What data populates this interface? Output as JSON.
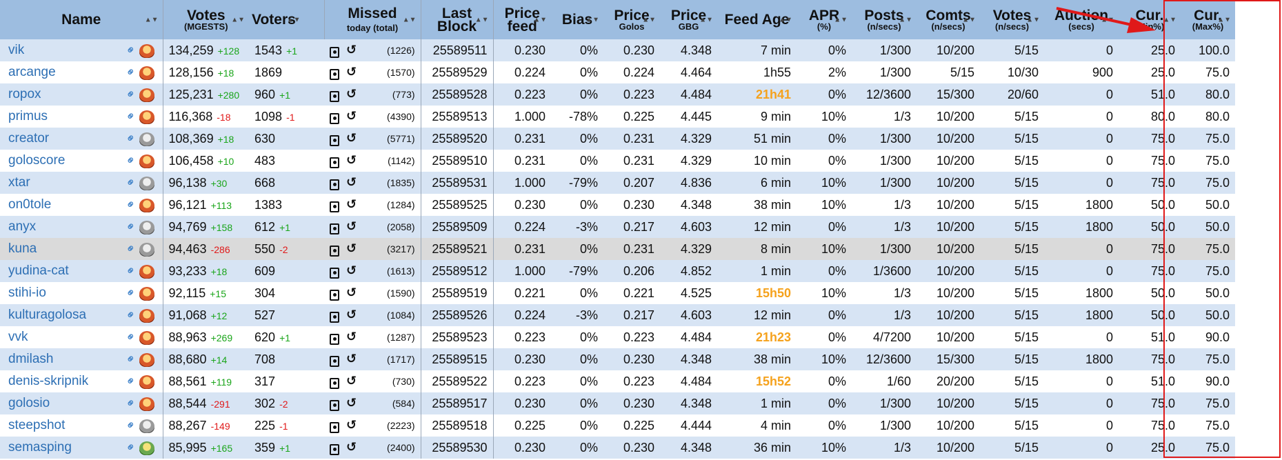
{
  "colors": {
    "header_bg": "#9dbde0",
    "row_odd": "#d7e4f4",
    "row_even": "#ffffff",
    "row_highlight": "#dadada",
    "link": "#2d6fb4",
    "delta_pos": "#1aa51a",
    "delta_neg": "#e01919",
    "stale_feed": "#f5a21d",
    "annotation": "#e01919"
  },
  "header": {
    "name": "Name",
    "votes": "Votes",
    "votes_sub": "(MGESTS)",
    "voters": "Voters",
    "missed": "Missed",
    "missed_sub": "today (total)",
    "last_block": "Last Block",
    "price_feed": "Price feed",
    "bias": "Bias",
    "price_golos": "Price",
    "price_golos_sub": "Golos",
    "price_gbg": "Price",
    "price_gbg_sub": "GBG",
    "feed_age": "Feed Age",
    "apr": "APR",
    "apr_sub": "(%)",
    "posts": "Posts",
    "posts_sub": "(n/secs)",
    "comts": "Comts",
    "comts_sub": "(n/secs)",
    "votes2": "Votes",
    "votes2_sub": "(n/secs)",
    "auction": "Auction",
    "auction_sub": "(secs)",
    "cur_min": "Cur.",
    "cur_min_sub": "(Min%)",
    "cur_max": "Cur.",
    "cur_max_sub": "(Max%)"
  },
  "rows": [
    {
      "name": "vik",
      "avatar": "orange",
      "votes": "134,259",
      "votes_delta": "+128",
      "voters": "1543",
      "voters_delta": "+1",
      "missed": "(1226)",
      "block": "25589511",
      "price_feed": "0.230",
      "bias": "0%",
      "price_golos": "0.230",
      "price_gbg": "4.348",
      "feed_age": "7 min",
      "feed_stale": false,
      "apr": "0%",
      "posts": "1/300",
      "comts": "10/200",
      "votes_n": "5/15",
      "auction": "0",
      "cur_min": "25.0",
      "cur_max": "100.0"
    },
    {
      "name": "arcange",
      "avatar": "orange",
      "votes": "128,156",
      "votes_delta": "+18",
      "voters": "1869",
      "voters_delta": "",
      "missed": "(1570)",
      "block": "25589529",
      "price_feed": "0.224",
      "bias": "0%",
      "price_golos": "0.224",
      "price_gbg": "4.464",
      "feed_age": "1h55",
      "feed_stale": false,
      "apr": "2%",
      "posts": "1/300",
      "comts": "5/15",
      "votes_n": "10/30",
      "auction": "900",
      "cur_min": "25.0",
      "cur_max": "75.0"
    },
    {
      "name": "ropox",
      "avatar": "orange",
      "votes": "125,231",
      "votes_delta": "+280",
      "voters": "960",
      "voters_delta": "+1",
      "missed": "(773)",
      "block": "25589528",
      "price_feed": "0.223",
      "bias": "0%",
      "price_golos": "0.223",
      "price_gbg": "4.484",
      "feed_age": "21h41",
      "feed_stale": true,
      "apr": "0%",
      "posts": "12/3600",
      "comts": "15/300",
      "votes_n": "20/60",
      "auction": "0",
      "cur_min": "51.0",
      "cur_max": "80.0"
    },
    {
      "name": "primus",
      "avatar": "orange",
      "votes": "116,368",
      "votes_delta": "-18",
      "voters": "1098",
      "voters_delta": "-1",
      "missed": "(4390)",
      "block": "25589513",
      "price_feed": "1.000",
      "bias": "-78%",
      "price_golos": "0.225",
      "price_gbg": "4.445",
      "feed_age": "9 min",
      "feed_stale": false,
      "apr": "10%",
      "posts": "1/3",
      "comts": "10/200",
      "votes_n": "5/15",
      "auction": "0",
      "cur_min": "80.0",
      "cur_max": "80.0"
    },
    {
      "name": "creator",
      "avatar": "grey",
      "votes": "108,369",
      "votes_delta": "+18",
      "voters": "630",
      "voters_delta": "",
      "missed": "(5771)",
      "block": "25589520",
      "price_feed": "0.231",
      "bias": "0%",
      "price_golos": "0.231",
      "price_gbg": "4.329",
      "feed_age": "51 min",
      "feed_stale": false,
      "apr": "0%",
      "posts": "1/300",
      "comts": "10/200",
      "votes_n": "5/15",
      "auction": "0",
      "cur_min": "75.0",
      "cur_max": "75.0"
    },
    {
      "name": "goloscore",
      "avatar": "orange",
      "votes": "106,458",
      "votes_delta": "+10",
      "voters": "483",
      "voters_delta": "",
      "missed": "(1142)",
      "block": "25589510",
      "price_feed": "0.231",
      "bias": "0%",
      "price_golos": "0.231",
      "price_gbg": "4.329",
      "feed_age": "10 min",
      "feed_stale": false,
      "apr": "0%",
      "posts": "1/300",
      "comts": "10/200",
      "votes_n": "5/15",
      "auction": "0",
      "cur_min": "75.0",
      "cur_max": "75.0"
    },
    {
      "name": "xtar",
      "avatar": "grey",
      "votes": "96,138",
      "votes_delta": "+30",
      "voters": "668",
      "voters_delta": "",
      "missed": "(1835)",
      "block": "25589531",
      "price_feed": "1.000",
      "bias": "-79%",
      "price_golos": "0.207",
      "price_gbg": "4.836",
      "feed_age": "6 min",
      "feed_stale": false,
      "apr": "10%",
      "posts": "1/300",
      "comts": "10/200",
      "votes_n": "5/15",
      "auction": "0",
      "cur_min": "75.0",
      "cur_max": "75.0"
    },
    {
      "name": "on0tole",
      "avatar": "orange",
      "votes": "96,121",
      "votes_delta": "+113",
      "voters": "1383",
      "voters_delta": "",
      "missed": "(1284)",
      "block": "25589525",
      "price_feed": "0.230",
      "bias": "0%",
      "price_golos": "0.230",
      "price_gbg": "4.348",
      "feed_age": "38 min",
      "feed_stale": false,
      "apr": "10%",
      "posts": "1/3",
      "comts": "10/200",
      "votes_n": "5/15",
      "auction": "1800",
      "cur_min": "50.0",
      "cur_max": "50.0"
    },
    {
      "name": "anyx",
      "avatar": "grey",
      "votes": "94,769",
      "votes_delta": "+158",
      "voters": "612",
      "voters_delta": "+1",
      "missed": "(2058)",
      "block": "25589509",
      "price_feed": "0.224",
      "bias": "-3%",
      "price_golos": "0.217",
      "price_gbg": "4.603",
      "feed_age": "12 min",
      "feed_stale": false,
      "apr": "0%",
      "posts": "1/3",
      "comts": "10/200",
      "votes_n": "5/15",
      "auction": "1800",
      "cur_min": "50.0",
      "cur_max": "50.0"
    },
    {
      "name": "kuna",
      "avatar": "grey",
      "votes": "94,463",
      "votes_delta": "-286",
      "voters": "550",
      "voters_delta": "-2",
      "missed": "(3217)",
      "block": "25589521",
      "price_feed": "0.231",
      "bias": "0%",
      "price_golos": "0.231",
      "price_gbg": "4.329",
      "feed_age": "8 min",
      "feed_stale": false,
      "apr": "10%",
      "posts": "1/300",
      "comts": "10/200",
      "votes_n": "5/15",
      "auction": "0",
      "cur_min": "75.0",
      "cur_max": "75.0",
      "highlight": true
    },
    {
      "name": "yudina-cat",
      "avatar": "orange",
      "votes": "93,233",
      "votes_delta": "+18",
      "voters": "609",
      "voters_delta": "",
      "missed": "(1613)",
      "block": "25589512",
      "price_feed": "1.000",
      "bias": "-79%",
      "price_golos": "0.206",
      "price_gbg": "4.852",
      "feed_age": "1 min",
      "feed_stale": false,
      "apr": "0%",
      "posts": "1/3600",
      "comts": "10/200",
      "votes_n": "5/15",
      "auction": "0",
      "cur_min": "75.0",
      "cur_max": "75.0"
    },
    {
      "name": "stihi-io",
      "avatar": "orange",
      "votes": "92,115",
      "votes_delta": "+15",
      "voters": "304",
      "voters_delta": "",
      "missed": "(1590)",
      "block": "25589519",
      "price_feed": "0.221",
      "bias": "0%",
      "price_golos": "0.221",
      "price_gbg": "4.525",
      "feed_age": "15h50",
      "feed_stale": true,
      "apr": "10%",
      "posts": "1/3",
      "comts": "10/200",
      "votes_n": "5/15",
      "auction": "1800",
      "cur_min": "50.0",
      "cur_max": "50.0"
    },
    {
      "name": "kulturagolosa",
      "avatar": "orange",
      "votes": "91,068",
      "votes_delta": "+12",
      "voters": "527",
      "voters_delta": "",
      "missed": "(1084)",
      "block": "25589526",
      "price_feed": "0.224",
      "bias": "-3%",
      "price_golos": "0.217",
      "price_gbg": "4.603",
      "feed_age": "12 min",
      "feed_stale": false,
      "apr": "0%",
      "posts": "1/3",
      "comts": "10/200",
      "votes_n": "5/15",
      "auction": "1800",
      "cur_min": "50.0",
      "cur_max": "50.0"
    },
    {
      "name": "vvk",
      "avatar": "orange",
      "votes": "88,963",
      "votes_delta": "+269",
      "voters": "620",
      "voters_delta": "+1",
      "missed": "(1287)",
      "block": "25589523",
      "price_feed": "0.223",
      "bias": "0%",
      "price_golos": "0.223",
      "price_gbg": "4.484",
      "feed_age": "21h23",
      "feed_stale": true,
      "apr": "0%",
      "posts": "4/7200",
      "comts": "10/200",
      "votes_n": "5/15",
      "auction": "0",
      "cur_min": "51.0",
      "cur_max": "90.0"
    },
    {
      "name": "dmilash",
      "avatar": "orange",
      "votes": "88,680",
      "votes_delta": "+14",
      "voters": "708",
      "voters_delta": "",
      "missed": "(1717)",
      "block": "25589515",
      "price_feed": "0.230",
      "bias": "0%",
      "price_golos": "0.230",
      "price_gbg": "4.348",
      "feed_age": "38 min",
      "feed_stale": false,
      "apr": "10%",
      "posts": "12/3600",
      "comts": "15/300",
      "votes_n": "5/15",
      "auction": "1800",
      "cur_min": "75.0",
      "cur_max": "75.0"
    },
    {
      "name": "denis-skripnik",
      "avatar": "orange",
      "votes": "88,561",
      "votes_delta": "+119",
      "voters": "317",
      "voters_delta": "",
      "missed": "(730)",
      "block": "25589522",
      "price_feed": "0.223",
      "bias": "0%",
      "price_golos": "0.223",
      "price_gbg": "4.484",
      "feed_age": "15h52",
      "feed_stale": true,
      "apr": "0%",
      "posts": "1/60",
      "comts": "20/200",
      "votes_n": "5/15",
      "auction": "0",
      "cur_min": "51.0",
      "cur_max": "90.0"
    },
    {
      "name": "golosio",
      "avatar": "orange",
      "votes": "88,544",
      "votes_delta": "-291",
      "voters": "302",
      "voters_delta": "-2",
      "missed": "(584)",
      "block": "25589517",
      "price_feed": "0.230",
      "bias": "0%",
      "price_golos": "0.230",
      "price_gbg": "4.348",
      "feed_age": "1 min",
      "feed_stale": false,
      "apr": "0%",
      "posts": "1/300",
      "comts": "10/200",
      "votes_n": "5/15",
      "auction": "0",
      "cur_min": "75.0",
      "cur_max": "75.0"
    },
    {
      "name": "steepshot",
      "avatar": "grey",
      "votes": "88,267",
      "votes_delta": "-149",
      "voters": "225",
      "voters_delta": "-1",
      "missed": "(2223)",
      "block": "25589518",
      "price_feed": "0.225",
      "bias": "0%",
      "price_golos": "0.225",
      "price_gbg": "4.444",
      "feed_age": "4 min",
      "feed_stale": false,
      "apr": "0%",
      "posts": "1/300",
      "comts": "10/200",
      "votes_n": "5/15",
      "auction": "0",
      "cur_min": "75.0",
      "cur_max": "75.0"
    },
    {
      "name": "semasping",
      "avatar": "green",
      "votes": "85,995",
      "votes_delta": "+165",
      "voters": "359",
      "voters_delta": "+1",
      "missed": "(2400)",
      "block": "25589530",
      "price_feed": "0.230",
      "bias": "0%",
      "price_golos": "0.230",
      "price_gbg": "4.348",
      "feed_age": "36 min",
      "feed_stale": false,
      "apr": "10%",
      "posts": "1/3",
      "comts": "10/200",
      "votes_n": "5/15",
      "auction": "0",
      "cur_min": "25.0",
      "cur_max": "75.0"
    }
  ]
}
